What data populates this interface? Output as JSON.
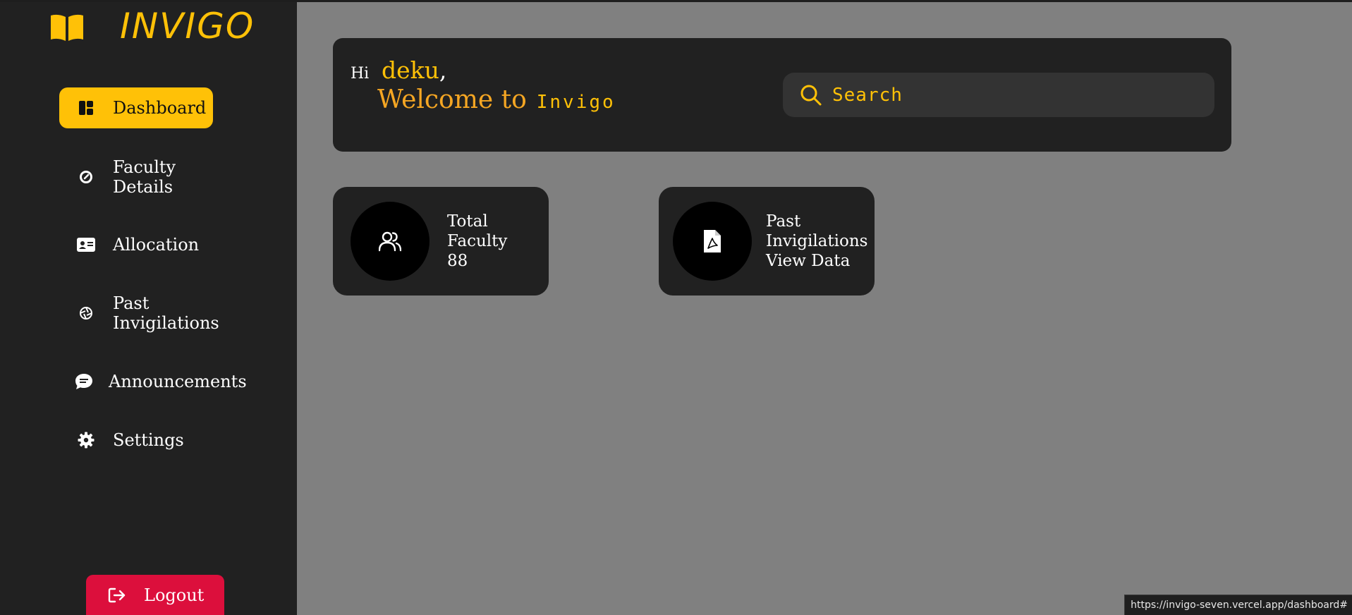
{
  "app": {
    "name": "INVIGO"
  },
  "sidebar": {
    "items": [
      {
        "label": "Dashboard",
        "icon": "dashboard-icon",
        "active": true
      },
      {
        "label": "Faculty Details",
        "icon": "gauge-icon",
        "active": false
      },
      {
        "label": "Allocation",
        "icon": "id-card-icon",
        "active": false
      },
      {
        "label": "Past Invigilations",
        "icon": "aperture-icon",
        "active": false
      },
      {
        "label": "Announcements",
        "icon": "chat-icon",
        "active": false
      },
      {
        "label": "Settings",
        "icon": "gear-icon",
        "active": false
      }
    ],
    "logout_label": "Logout"
  },
  "header": {
    "hi": "Hi",
    "username": "deku",
    "comma": ",",
    "welcome": "Welcome to",
    "app_name": "Invigo",
    "search_placeholder": "Search"
  },
  "cards": [
    {
      "line1": "Total",
      "line2": "Faculty",
      "line3": "88",
      "icon": "users-icon"
    },
    {
      "line1": "Past",
      "line2": "Invigilations",
      "line3": "View Data",
      "icon": "pdf-file-icon"
    }
  ],
  "status_url": "https://invigo-seven.vercel.app/dashboard#",
  "colors": {
    "accent": "#ffc107",
    "sidebar": "#212121",
    "background": "#808080",
    "logout": "#dc0f3c",
    "welcome": "#f5a623"
  }
}
